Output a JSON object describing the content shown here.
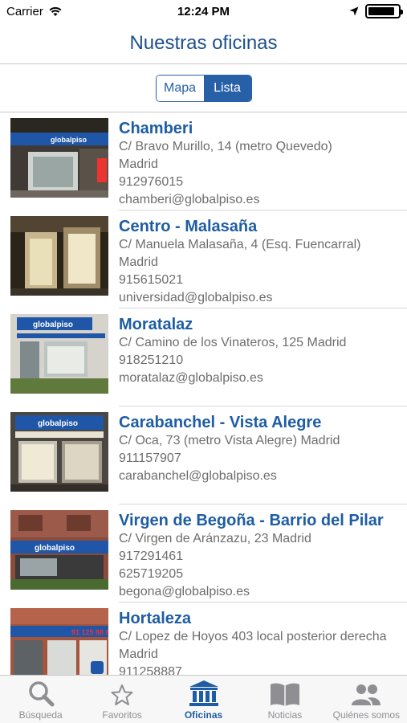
{
  "status_bar": {
    "carrier": "Carrier",
    "time": "12:24 PM",
    "battery_percent": 90
  },
  "nav": {
    "title": "Nuestras oficinas"
  },
  "segmented": {
    "options": [
      "Mapa",
      "Lista"
    ],
    "selected": "Lista"
  },
  "offices": [
    {
      "name": "Chamberi",
      "lines": [
        "C/ Bravo Murillo, 14 (metro Quevedo)",
        "Madrid",
        "912976015",
        "chamberi@globalpiso.es"
      ]
    },
    {
      "name": "Centro - Malasaña",
      "lines": [
        "C/ Manuela Malasaña, 4 (Esq. Fuencarral)",
        "Madrid",
        "915615021",
        "universidad@globalpiso.es"
      ]
    },
    {
      "name": "Moratalaz",
      "lines": [
        "C/ Camino de los Vinateros, 125 Madrid",
        "918251210",
        "moratalaz@globalpiso.es"
      ]
    },
    {
      "name": "Carabanchel - Vista Alegre",
      "lines": [
        "C/ Oca, 73 (metro Vista Alegre) Madrid",
        "911157907",
        "carabanchel@globalpiso.es"
      ]
    },
    {
      "name": "Virgen de Begoña - Barrio del Pilar",
      "lines": [
        "C/ Virgen de Aránzazu, 23 Madrid",
        "917291461",
        "625719205",
        "begona@globalpiso.es"
      ]
    },
    {
      "name": "Hortaleza",
      "lines": [
        "C/ Lopez de Hoyos 403 local posterior derecha Madrid",
        "911258887"
      ]
    }
  ],
  "tabs": [
    {
      "label": "Búsqueda",
      "icon": "search-icon"
    },
    {
      "label": "Favoritos",
      "icon": "star-icon"
    },
    {
      "label": "Oficinas",
      "icon": "building-icon"
    },
    {
      "label": "Noticias",
      "icon": "book-icon"
    },
    {
      "label": "Quiénes somos",
      "icon": "people-icon"
    }
  ],
  "active_tab": "Oficinas",
  "colors": {
    "brand_blue": "#1e5da3",
    "accent_blue": "#2860a8",
    "tab_inactive": "#8e8e93"
  }
}
